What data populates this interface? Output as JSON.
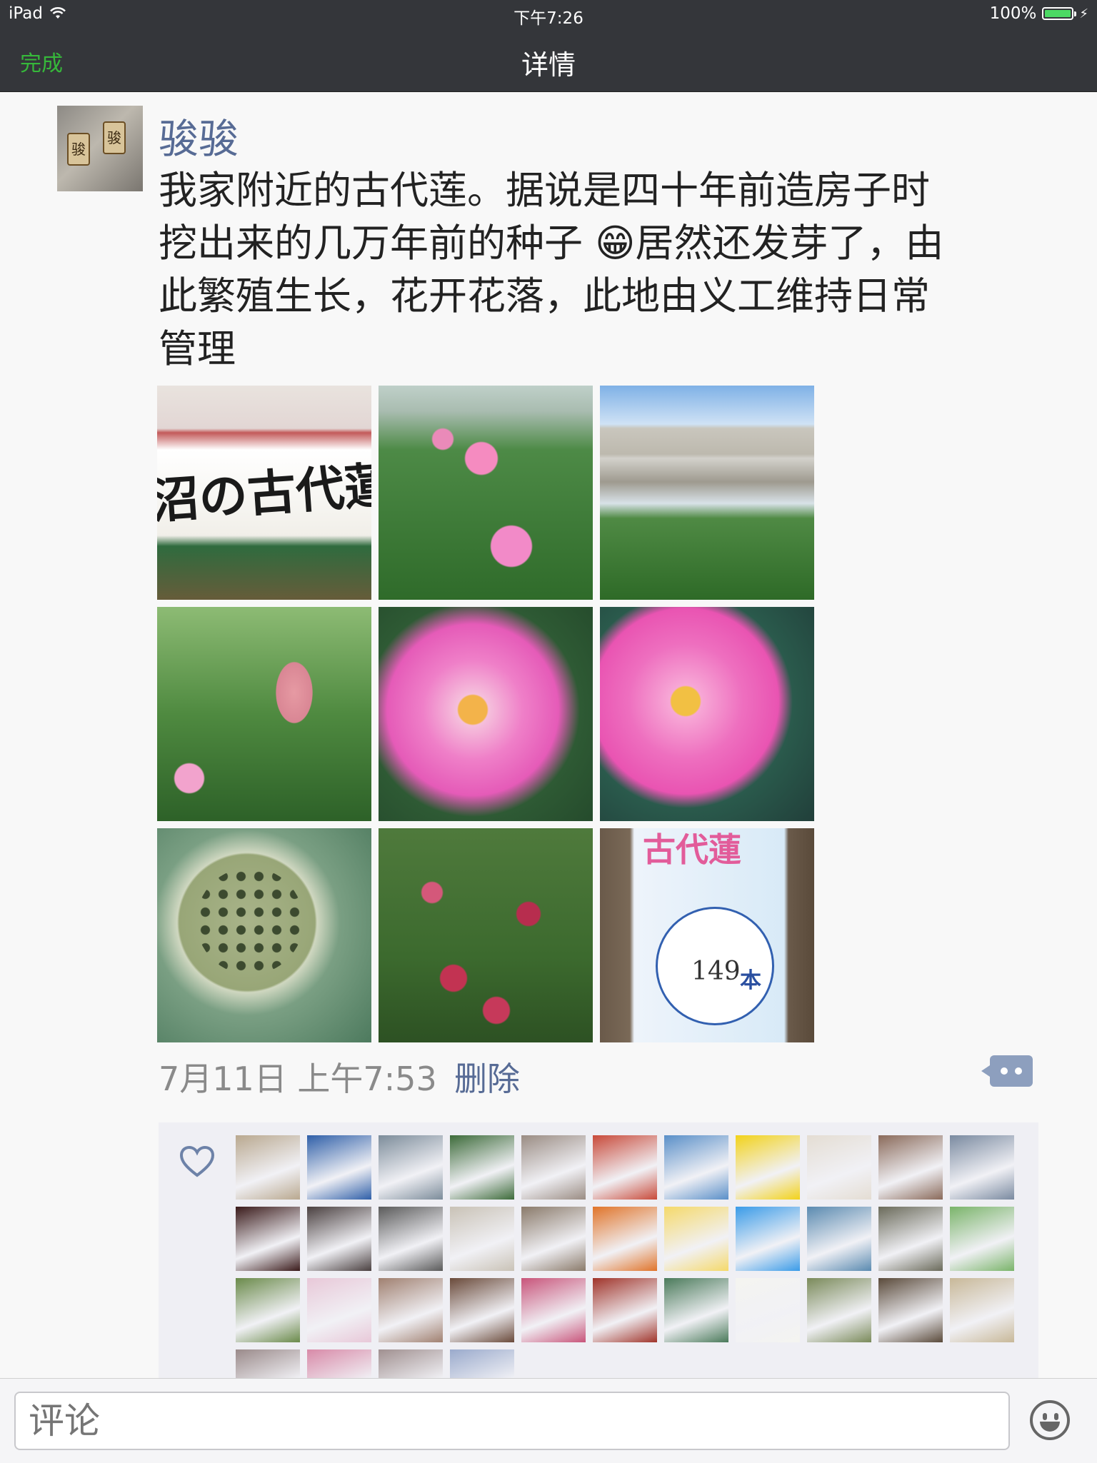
{
  "status_bar": {
    "device": "iPad",
    "time": "下午7:26",
    "battery": "100%",
    "battery_level": 1.0
  },
  "nav": {
    "done_label": "完成",
    "title": "详情"
  },
  "post": {
    "author": "骏骏",
    "text_line1": "我家附近的古代莲。据说是四十年前造房子时",
    "text_line2a": "挖出来的几万年前的种子 ",
    "emoji": "😁",
    "text_line2b": "居然还发芽了，由",
    "text_line3": "此繁殖生长，花开花落，此地由义工维持日常",
    "text_line4": "管理",
    "photo_texts": {
      "sign": "沼の古代蓮",
      "board_title": "古代蓮",
      "board_count": "149",
      "board_unit": "本"
    },
    "timestamp": "7月11日 上午7:53",
    "delete_label": "删除"
  },
  "likes": {
    "count_rows": 4,
    "liker_colors": [
      "#b9a88f",
      "#2f5fa8",
      "#7c8c9a",
      "#3d6b3a",
      "#9a8c83",
      "#c84a3a",
      "#5a8fc8",
      "#f2d21a",
      "#e4ddd3",
      "#8a6a5a",
      "#7a8aa0",
      "#3a1a1a",
      "#4a4040",
      "#5a5a5a",
      "#c9c2b6",
      "#8a7a6a",
      "#e0742a",
      "#f5d96a",
      "#3a9be8",
      "#5a8ab0",
      "#6a6a5a",
      "#7ab46a",
      "#6a8a4a",
      "#e8c8d8",
      "#a08070",
      "#6a4a3a",
      "#c8547a",
      "#a0342a",
      "#4a7a5a",
      "#f4f4f0",
      "#7a8a5a",
      "#5a4a3a",
      "#c8b898",
      "#9a8a8a",
      "#d88aa8",
      "#a09090",
      "#9aaacc"
    ]
  },
  "comment_bar": {
    "placeholder": "评论"
  },
  "colors": {
    "bar_bg": "#34363a",
    "done_green": "#36b83a",
    "link_blue": "#576b95",
    "likes_bg": "#efeff4"
  },
  "icons": [
    "wifi-icon",
    "battery-icon",
    "charging-icon",
    "comment-icon",
    "heart-icon",
    "emoji-icon"
  ]
}
